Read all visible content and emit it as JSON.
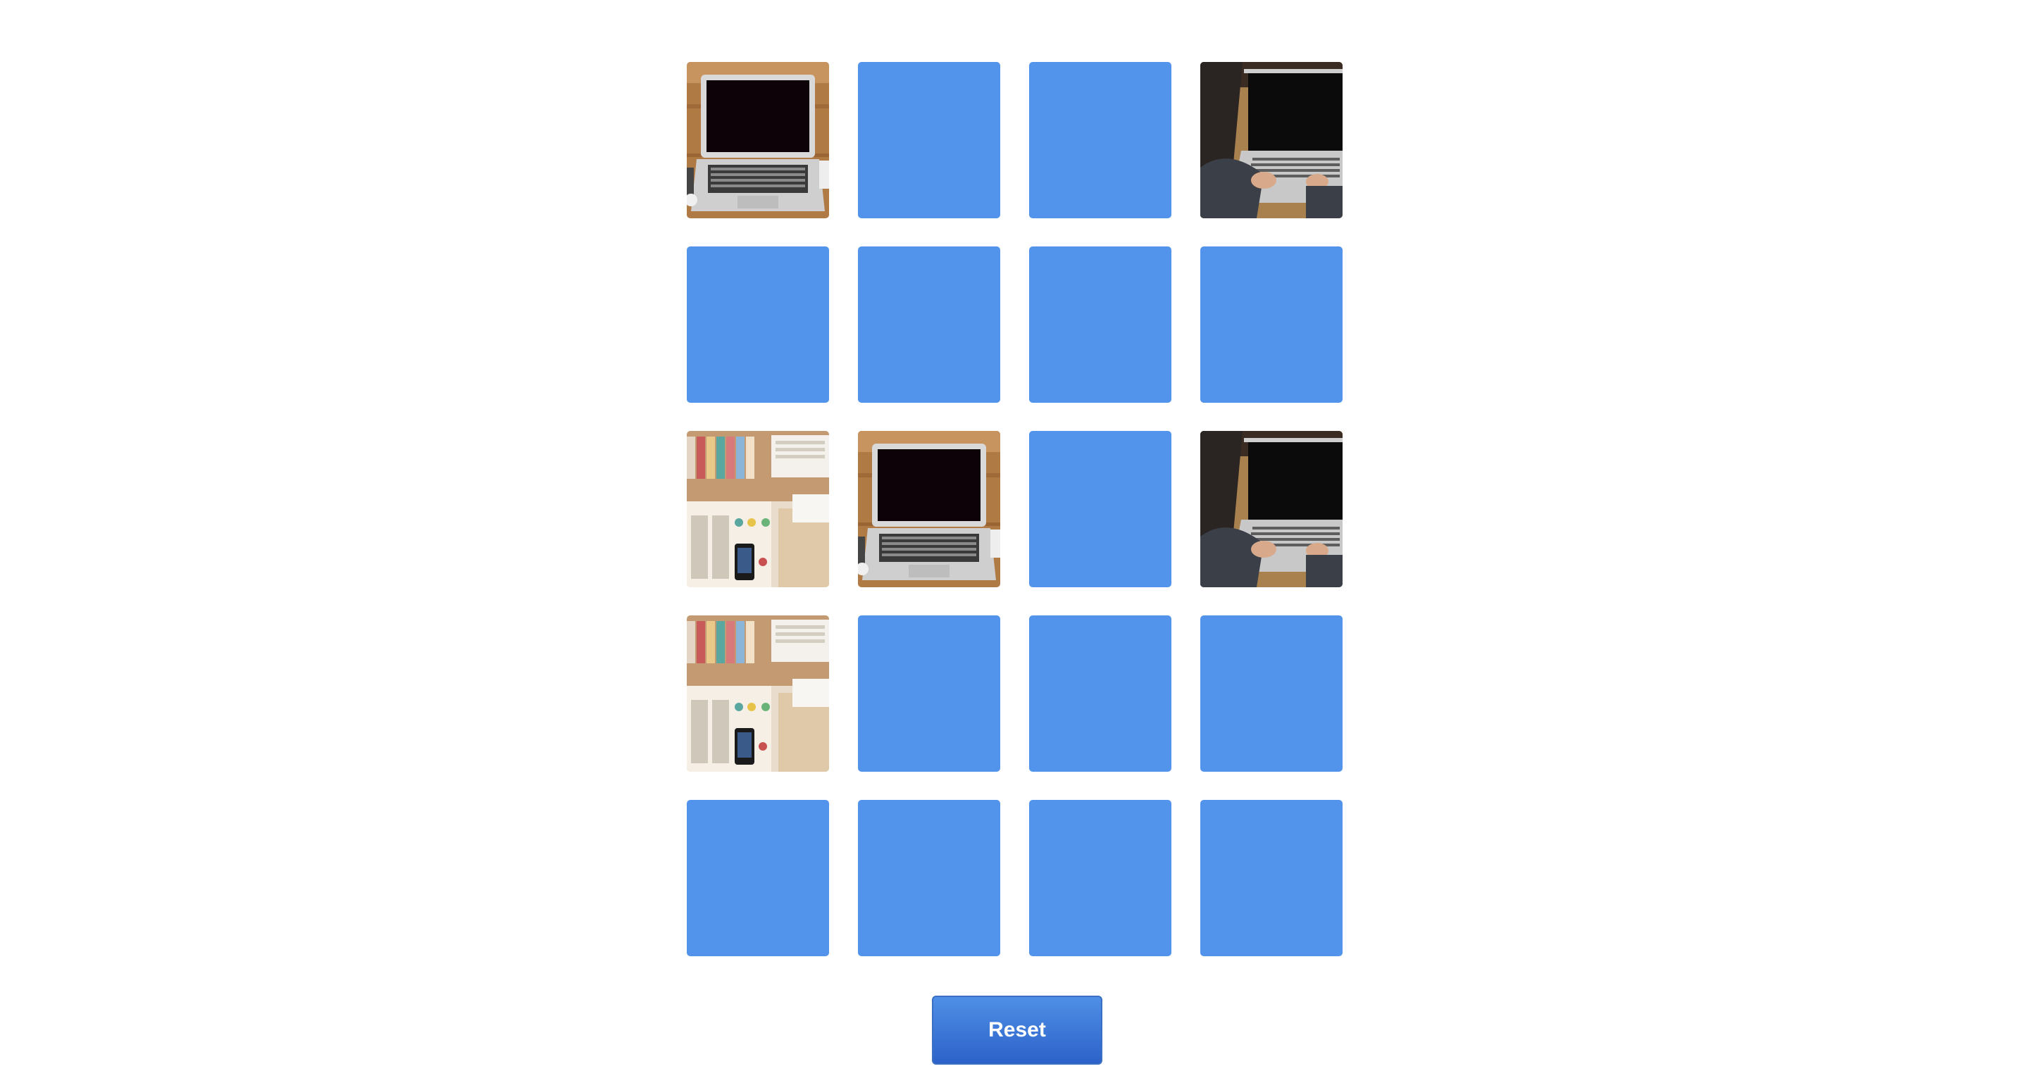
{
  "board": {
    "rows": 5,
    "cols": 4,
    "cards": [
      {
        "state": "face-up",
        "image": "laptop-on-desk-image"
      },
      {
        "state": "face-down",
        "image": null
      },
      {
        "state": "face-down",
        "image": null
      },
      {
        "state": "face-up",
        "image": "person-typing-laptop-image"
      },
      {
        "state": "face-down",
        "image": null
      },
      {
        "state": "face-down",
        "image": null
      },
      {
        "state": "face-down",
        "image": null
      },
      {
        "state": "face-down",
        "image": null
      },
      {
        "state": "face-up",
        "image": "desk-books-phone-image"
      },
      {
        "state": "face-up",
        "image": "laptop-on-desk-image"
      },
      {
        "state": "face-down",
        "image": null
      },
      {
        "state": "face-up",
        "image": "person-typing-laptop-image"
      },
      {
        "state": "face-up",
        "image": "desk-books-phone-image"
      },
      {
        "state": "face-down",
        "image": null
      },
      {
        "state": "face-down",
        "image": null
      },
      {
        "state": "face-down",
        "image": null
      },
      {
        "state": "face-down",
        "image": null
      },
      {
        "state": "face-down",
        "image": null
      },
      {
        "state": "face-down",
        "image": null
      },
      {
        "state": "face-down",
        "image": null
      }
    ]
  },
  "colors": {
    "card_back": "#5294ec",
    "button": "#2f66cc"
  },
  "reset_button": {
    "label": "Reset"
  }
}
